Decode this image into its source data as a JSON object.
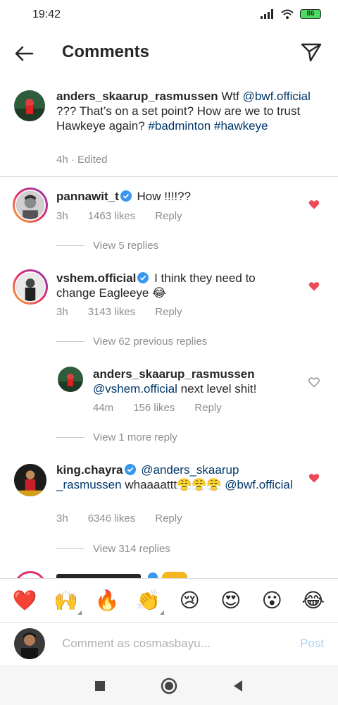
{
  "status_bar": {
    "time": "19:42",
    "battery": "86"
  },
  "header": {
    "title": "Comments"
  },
  "caption": {
    "username": "anders_skaarup_rasmussen",
    "text_1": " Wtf ",
    "mention": "@bwf.official",
    "text_2": " ??? That’s on a set point? How are we to trust Hawkeye again? ",
    "tag_1": "#badminton",
    "tag_2": "#hawkeye",
    "meta": "4h · Edited"
  },
  "comments": [
    {
      "username": "pannawit_t",
      "text": " How !!!!??",
      "time": "3h",
      "likes": "1463 likes",
      "reply": "Reply",
      "view_replies": "View 5 replies"
    },
    {
      "username": "vshem.official",
      "text": " I think they need to change Eagleeye 😂",
      "time": "3h",
      "likes": "3143 likes",
      "reply": "Reply",
      "view_replies": "View 62 previous replies"
    },
    {
      "username": "king.chayra",
      "mention_1": "@anders_skaarup _rasmussen",
      "text": " whaaaattt😤😤😤 ",
      "mention_2": "@bwf.official",
      "time": "3h",
      "likes": "6346 likes",
      "reply": "Reply",
      "view_replies": "View 314 replies"
    }
  ],
  "reply": {
    "username": "anders_skaarup_rasmussen",
    "mention": "@vshem.official",
    "text": " next level shit!",
    "time": "44m",
    "likes": "156 likes",
    "reply": "Reply",
    "view_more": "View 1 more reply"
  },
  "emoji_bar": [
    "❤️",
    "🙌",
    "🔥",
    "👏",
    "😢",
    "😍",
    "😮",
    "😂"
  ],
  "composer": {
    "placeholder": "Comment as cosmasbayu...",
    "post": "Post"
  },
  "colors": {
    "link": "#00376b",
    "like_red": "#ed4956",
    "muted": "#8e8e8e",
    "post_disabled": "#a8d4f7"
  },
  "icons": [
    "back-arrow-icon",
    "send-icon",
    "verified-icon",
    "heart-filled-icon",
    "heart-outline-icon",
    "nav-square-icon",
    "nav-circle-icon",
    "nav-back-triangle-icon"
  ]
}
